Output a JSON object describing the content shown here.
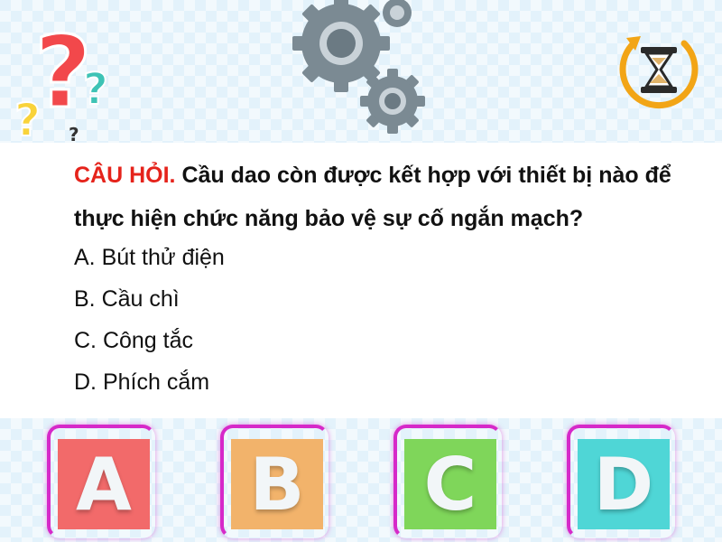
{
  "question": {
    "prefix": "CÂU HỎI.",
    "text": "Cầu dao còn được kết hợp với thiết bị nào để thực hiện chức năng bảo vệ sự cố ngắn mạch?"
  },
  "options": [
    {
      "label": "A. Bút thử điện"
    },
    {
      "label": "B. Cầu chì"
    },
    {
      "label": "C. Công tắc"
    },
    {
      "label": "D. Phích cắm"
    }
  ],
  "answer_buttons": [
    {
      "letter": "A",
      "color": "#f26a6a"
    },
    {
      "letter": "B",
      "color": "#f2b36b"
    },
    {
      "letter": "C",
      "color": "#7fd65a"
    },
    {
      "letter": "D",
      "color": "#4fd6d6"
    }
  ],
  "icons": {
    "question_marks": "question-marks-icon",
    "gears": "gears-icon",
    "timer": "hourglass-timer-icon"
  },
  "colors": {
    "accent_red": "#e5231b",
    "timer_orange": "#f2a516",
    "background": "#e3f2fb"
  }
}
